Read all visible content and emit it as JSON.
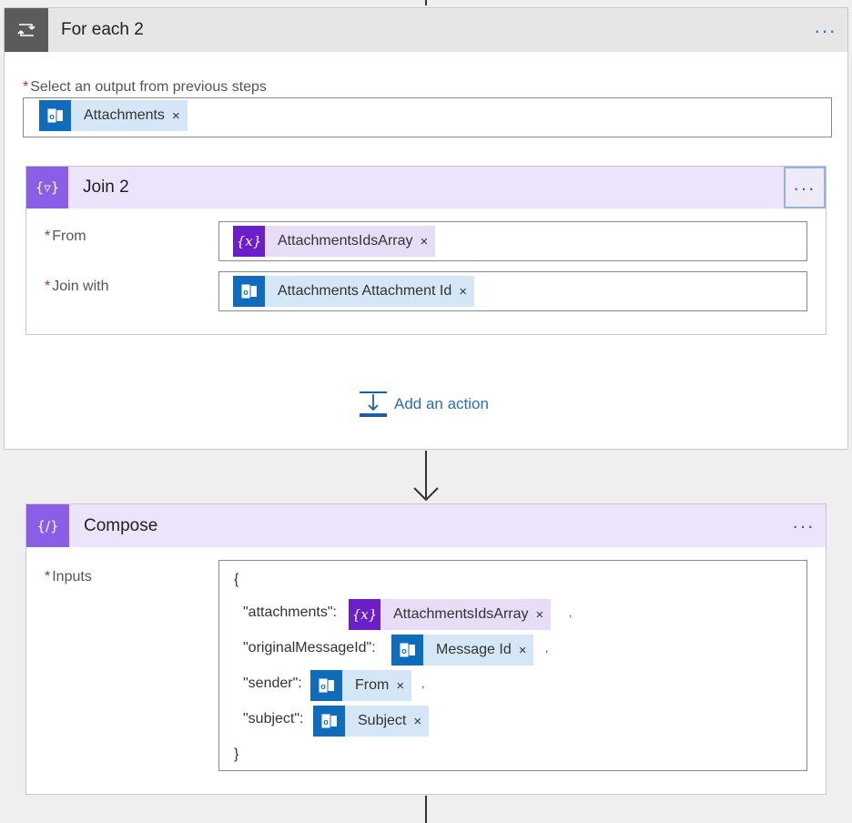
{
  "foreach": {
    "title": "For each 2",
    "more": "···",
    "select_label": "Select an output from previous steps",
    "required_mark": "*",
    "token": {
      "label": "Attachments",
      "remove": "×",
      "icon": "outlook-icon"
    }
  },
  "join": {
    "title": "Join 2",
    "more": "···",
    "from_label": "From",
    "joinwith_label": "Join with",
    "from_token": {
      "label": "AttachmentsIdsArray",
      "remove": "×",
      "icon": "variable-icon",
      "icon_text": "{x}"
    },
    "joinwith_token": {
      "label": "Attachments Attachment Id",
      "remove": "×",
      "icon": "outlook-icon"
    }
  },
  "add_action": {
    "label": "Add an action"
  },
  "compose": {
    "title": "Compose",
    "more": "···",
    "inputs_label": "Inputs",
    "open_brace": "{",
    "close_brace": "}",
    "lines": [
      {
        "key": "\"attachments\":",
        "token": "AttachmentsIdsArray",
        "icon": "variable-icon",
        "icon_text": "{x}",
        "remove": "×",
        "suffix": ","
      },
      {
        "key": "\"originalMessageId\":",
        "token": "Message Id",
        "icon": "outlook-icon",
        "remove": "×",
        "suffix": ","
      },
      {
        "key": "\"sender\":",
        "token": "From",
        "icon": "outlook-icon",
        "remove": "×",
        "suffix": ","
      },
      {
        "key": "\"subject\":",
        "token": "Subject",
        "icon": "outlook-icon",
        "remove": "×",
        "suffix": ""
      }
    ]
  },
  "colors": {
    "outlook": "#0f6cbd",
    "variable": "#6b1fc8",
    "link": "#2a6fb5",
    "purple_header": "#ece4fa"
  }
}
